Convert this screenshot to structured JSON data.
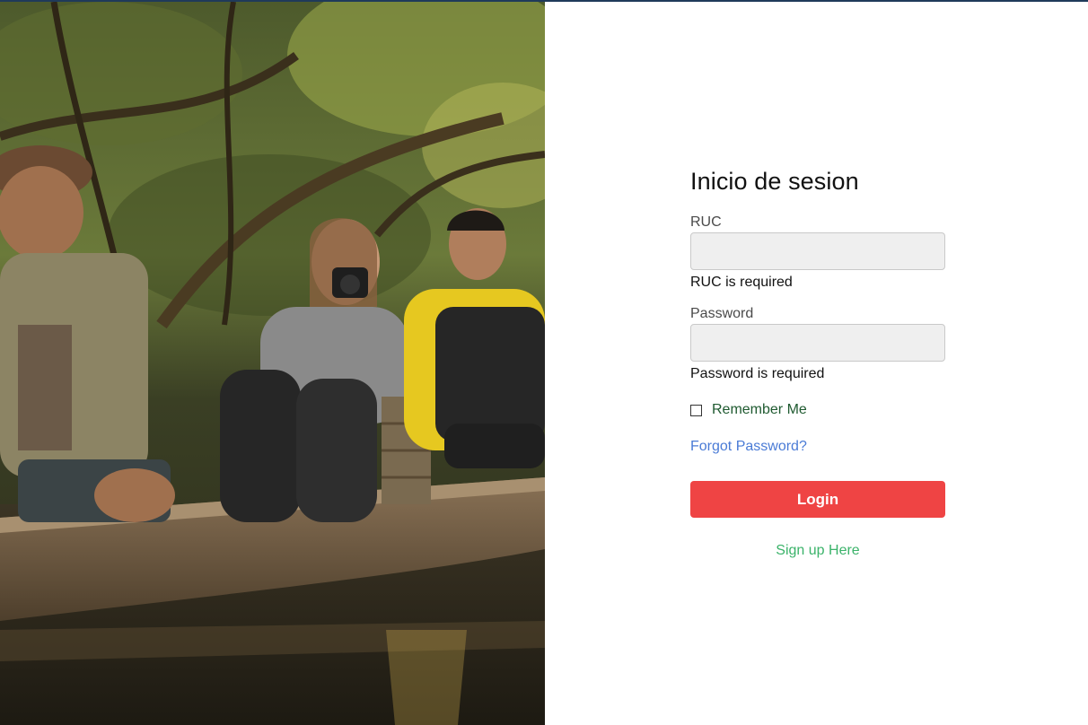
{
  "form": {
    "title": "Inicio de sesion",
    "ruc_label": "RUC",
    "ruc_value": "",
    "ruc_error": "RUC is required",
    "password_label": "Password",
    "password_value": "",
    "password_error": "Password is required",
    "remember_label": "Remember Me",
    "remember_checked": false,
    "forgot_label": "Forgot Password?",
    "login_label": "Login",
    "signup_label": "Sign up Here"
  },
  "colors": {
    "login_button": "#ef4444",
    "signup_link": "#3bb36a",
    "forgot_link": "#4a7bd6",
    "top_bar": "#1f3a5a"
  }
}
